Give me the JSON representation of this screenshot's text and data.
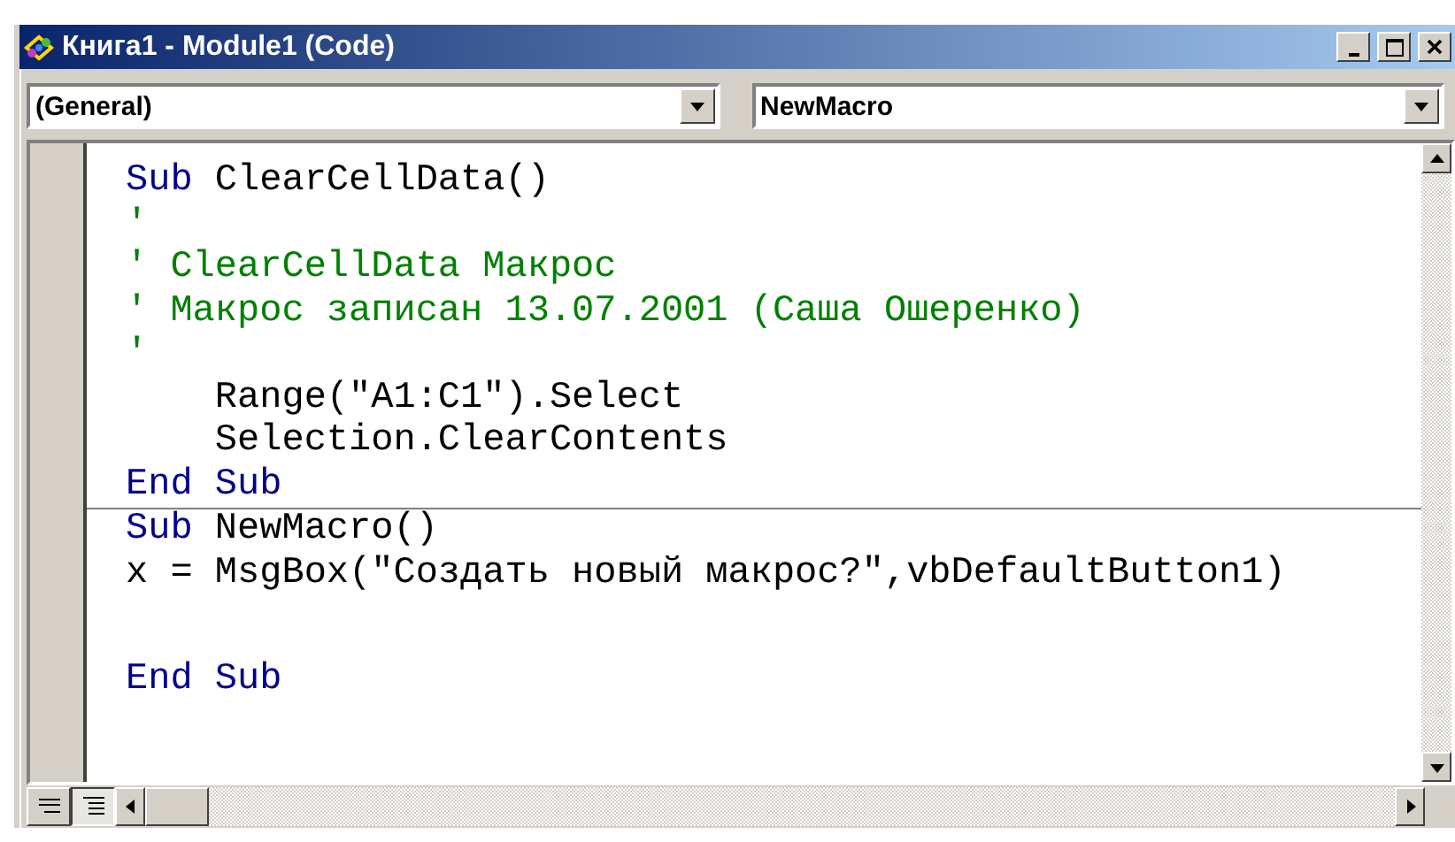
{
  "window": {
    "title": "Книга1 - Module1 (Code)"
  },
  "object_combo": {
    "value": "(General)"
  },
  "procedure_combo": {
    "value": "NewMacro"
  },
  "procedures": [
    {
      "lines": [
        {
          "segments": [
            {
              "kind": "keyword",
              "text": "Sub"
            },
            {
              "kind": "text",
              "text": " ClearCellData()"
            }
          ]
        },
        {
          "segments": [
            {
              "kind": "comment",
              "text": "'"
            }
          ]
        },
        {
          "segments": [
            {
              "kind": "comment",
              "text": "' ClearCellData Макрос"
            }
          ]
        },
        {
          "segments": [
            {
              "kind": "comment",
              "text": "' Макрос записан 13.07.2001 (Саша Ошеренко)"
            }
          ]
        },
        {
          "segments": [
            {
              "kind": "comment",
              "text": "'"
            }
          ]
        },
        {
          "segments": [
            {
              "kind": "text",
              "text": "    Range(\"A1:C1\").Select"
            }
          ]
        },
        {
          "segments": [
            {
              "kind": "text",
              "text": "    Selection.ClearContents"
            }
          ]
        },
        {
          "segments": [
            {
              "kind": "keyword",
              "text": "End Sub"
            }
          ]
        }
      ]
    },
    {
      "lines": [
        {
          "segments": [
            {
              "kind": "keyword",
              "text": "Sub"
            },
            {
              "kind": "text",
              "text": " NewMacro()"
            }
          ]
        },
        {
          "segments": [
            {
              "kind": "text",
              "text": "x = MsgBox(\"Создать новый макрос?\",vbDefaultButton1)"
            }
          ]
        },
        {
          "kind": "blank"
        },
        {
          "segments": [
            {
              "kind": "keyword",
              "text": "End Sub"
            }
          ]
        }
      ]
    }
  ],
  "view_buttons": [
    {
      "selected": false
    },
    {
      "selected": true
    }
  ]
}
